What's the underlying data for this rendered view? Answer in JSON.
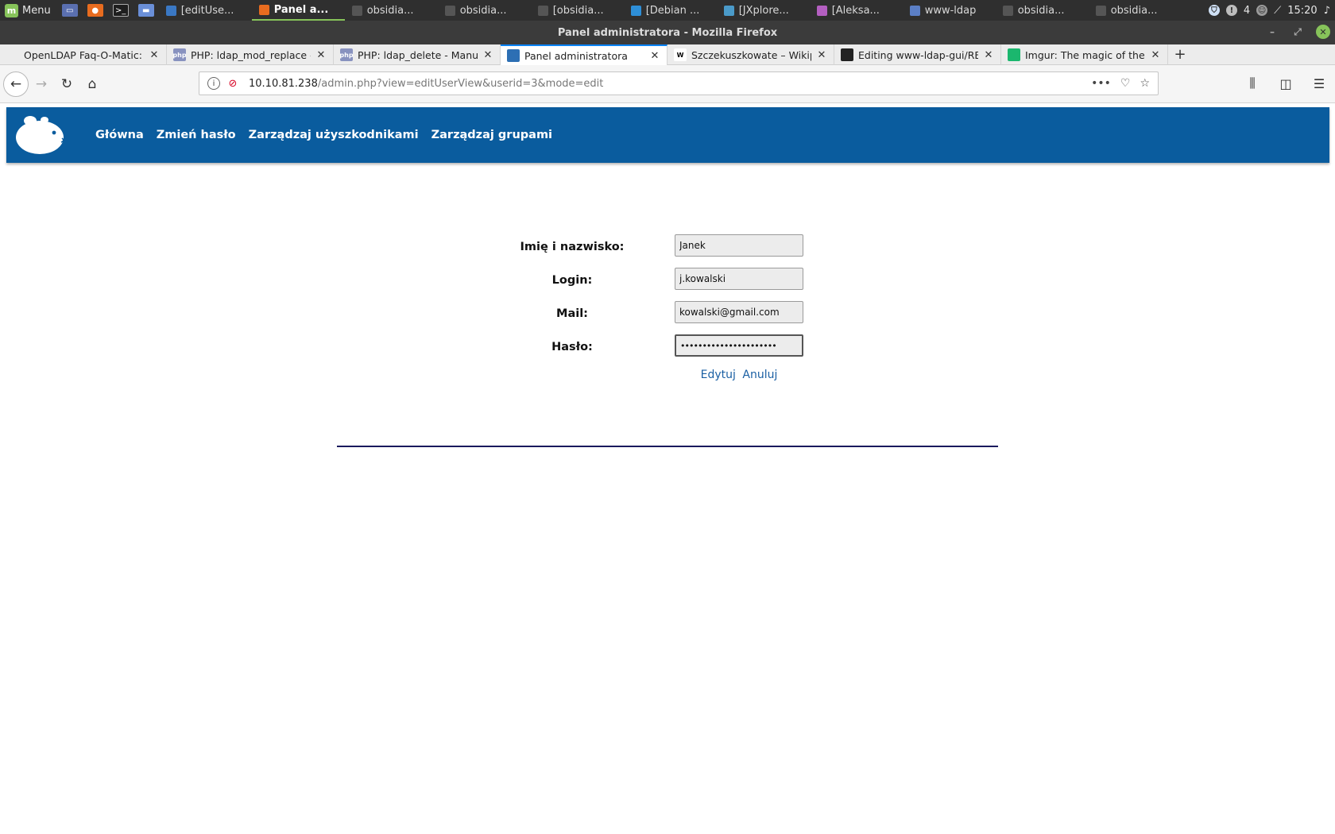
{
  "taskbar": {
    "menu_label": "Menu",
    "tasks": [
      {
        "label": "[editUse...",
        "active": false,
        "color": "#3a78c4"
      },
      {
        "label": "Panel a...",
        "active": true,
        "color": "#e86c1f"
      },
      {
        "label": "obsidia...",
        "active": false,
        "color": "#555555"
      },
      {
        "label": "obsidia...",
        "active": false,
        "color": "#555555"
      },
      {
        "label": "[obsidia...",
        "active": false,
        "color": "#555555"
      },
      {
        "label": "[Debian ...",
        "active": false,
        "color": "#2e8fd8"
      },
      {
        "label": "[JXplore...",
        "active": false,
        "color": "#4a9ac9"
      },
      {
        "label": "[Aleksa...",
        "active": false,
        "color": "#b45fc1"
      },
      {
        "label": "www-ldap",
        "active": false,
        "color": "#5b7fc6"
      },
      {
        "label": "obsidia...",
        "active": false,
        "color": "#555555"
      },
      {
        "label": "obsidia...",
        "active": false,
        "color": "#555555"
      }
    ],
    "tray_count": "4",
    "clock": "15:20"
  },
  "window": {
    "title": "Panel administratora - Mozilla Firefox"
  },
  "tabs": [
    {
      "title": "OpenLDAP Faq-O-Matic: ldap_add",
      "icon": "",
      "icon_color": "transparent",
      "active": false
    },
    {
      "title": "PHP: ldap_mod_replace - Manual",
      "icon": "php",
      "icon_color": "#8892bf",
      "active": false
    },
    {
      "title": "PHP: ldap_delete - Manual",
      "icon": "php",
      "icon_color": "#8892bf",
      "active": false
    },
    {
      "title": "Panel administratora",
      "icon": "",
      "icon_color": "#2d6fb4",
      "active": true
    },
    {
      "title": "Szczekuszkowate – Wikipedia",
      "icon": "W",
      "icon_color": "#ffffff",
      "active": false
    },
    {
      "title": "Editing www-ldap-gui/README",
      "icon": "",
      "icon_color": "#222222",
      "active": false
    },
    {
      "title": "Imgur: The magic of the Intern",
      "icon": "",
      "icon_color": "#1bb76e",
      "active": false
    }
  ],
  "navbar": {
    "url_host": "10.10.81.238",
    "url_path": "/admin.php?view=editUserView&userid=3&mode=edit"
  },
  "site": {
    "header_color": "#0a5c9e",
    "nav": [
      "Główna",
      "Zmień hasło",
      "Zarządzaj użyszkodnikami",
      "Zarządzaj grupami"
    ]
  },
  "form": {
    "fullname_label": "Imię i nazwisko:",
    "fullname_value": "Janek",
    "login_label": "Login:",
    "login_value": "j.kowalski",
    "mail_label": "Mail:",
    "mail_value": "kowalski@gmail.com",
    "password_label": "Hasło:",
    "password_value": "••••••••••••••••••••••",
    "edit_link": "Edytuj",
    "cancel_link": "Anuluj"
  }
}
